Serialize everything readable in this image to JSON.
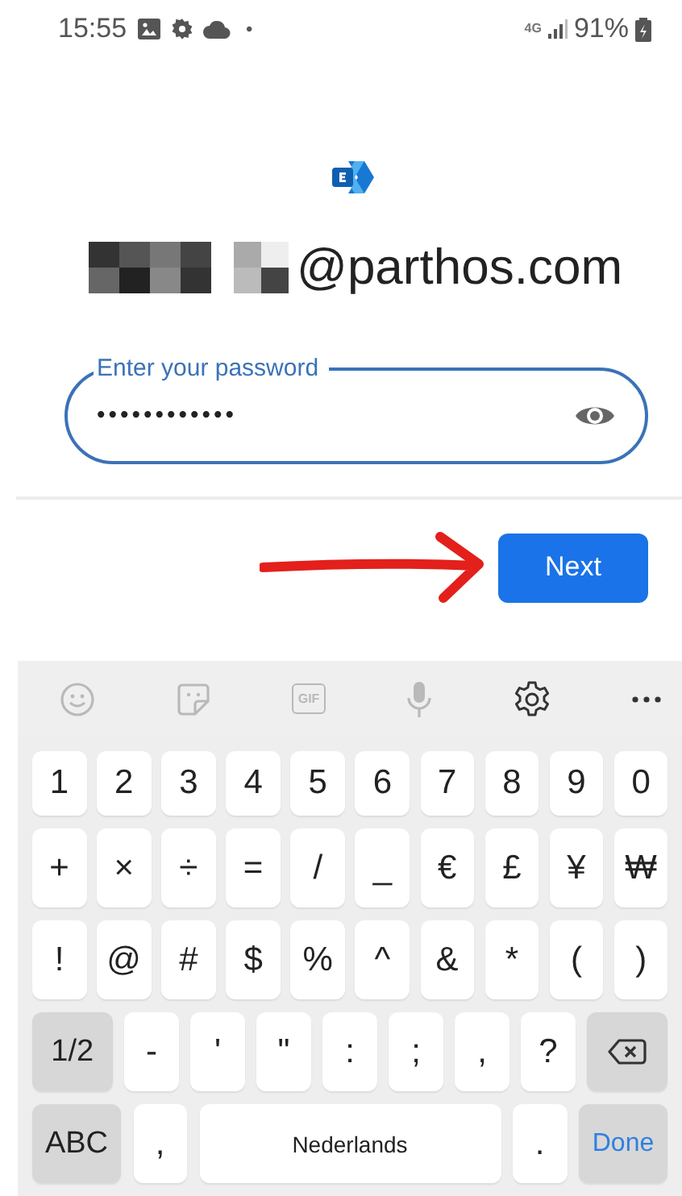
{
  "status_bar": {
    "time": "15:55",
    "notification_dot": "•",
    "network": "4G",
    "battery": "91%"
  },
  "account": {
    "redacted": true,
    "email_visible": "@parthos.com"
  },
  "password_field": {
    "label": "Enter your password",
    "value": "••••••••••••",
    "focused": true
  },
  "annotations": [
    {
      "kind": "arrow"
    }
  ],
  "next_button": {
    "label": "Next"
  },
  "keyboard": {
    "toolbar": {
      "gif_label": "GIF"
    },
    "key_rows": [
      {
        "keys": [
          {
            "label": "1",
            "kind": "char"
          },
          {
            "label": "2",
            "kind": "char"
          },
          {
            "label": "3",
            "kind": "char"
          },
          {
            "label": "4",
            "kind": "char"
          },
          {
            "label": "5",
            "kind": "char"
          },
          {
            "label": "6",
            "kind": "char"
          },
          {
            "label": "7",
            "kind": "char"
          },
          {
            "label": "8",
            "kind": "char"
          },
          {
            "label": "9",
            "kind": "char"
          },
          {
            "label": "0",
            "kind": "char"
          }
        ]
      },
      {
        "keys": [
          {
            "label": "+",
            "kind": "char"
          },
          {
            "label": "×",
            "kind": "char"
          },
          {
            "label": "÷",
            "kind": "char"
          },
          {
            "label": "=",
            "kind": "char"
          },
          {
            "label": "/",
            "kind": "char"
          },
          {
            "label": "_",
            "kind": "char"
          },
          {
            "label": "€",
            "kind": "char"
          },
          {
            "label": "£",
            "kind": "char"
          },
          {
            "label": "¥",
            "kind": "char"
          },
          {
            "label": "₩",
            "kind": "char"
          }
        ]
      },
      {
        "keys": [
          {
            "label": "!",
            "kind": "char"
          },
          {
            "label": "@",
            "kind": "char"
          },
          {
            "label": "#",
            "kind": "char"
          },
          {
            "label": "$",
            "kind": "char"
          },
          {
            "label": "%",
            "kind": "char"
          },
          {
            "label": "^",
            "kind": "char"
          },
          {
            "label": "&",
            "kind": "char"
          },
          {
            "label": "*",
            "kind": "char"
          },
          {
            "label": "(",
            "kind": "char"
          },
          {
            "label": ")",
            "kind": "char"
          }
        ]
      },
      {
        "keys": [
          {
            "label": "1/2",
            "kind": "mode"
          },
          {
            "label": "-",
            "kind": "char"
          },
          {
            "label": "'",
            "kind": "char"
          },
          {
            "label": "\"",
            "kind": "char"
          },
          {
            "label": ":",
            "kind": "char"
          },
          {
            "label": ";",
            "kind": "char"
          },
          {
            "label": ",",
            "kind": "char"
          },
          {
            "label": "?",
            "kind": "char"
          },
          {
            "kind": "backspace"
          }
        ]
      },
      {
        "keys": [
          {
            "label": "ABC",
            "kind": "mode"
          },
          {
            "label": ",",
            "kind": "char"
          },
          {
            "label": "Nederlands",
            "kind": "space"
          },
          {
            "label": ".",
            "kind": "char"
          },
          {
            "label": "Done",
            "kind": "done"
          }
        ]
      }
    ]
  }
}
